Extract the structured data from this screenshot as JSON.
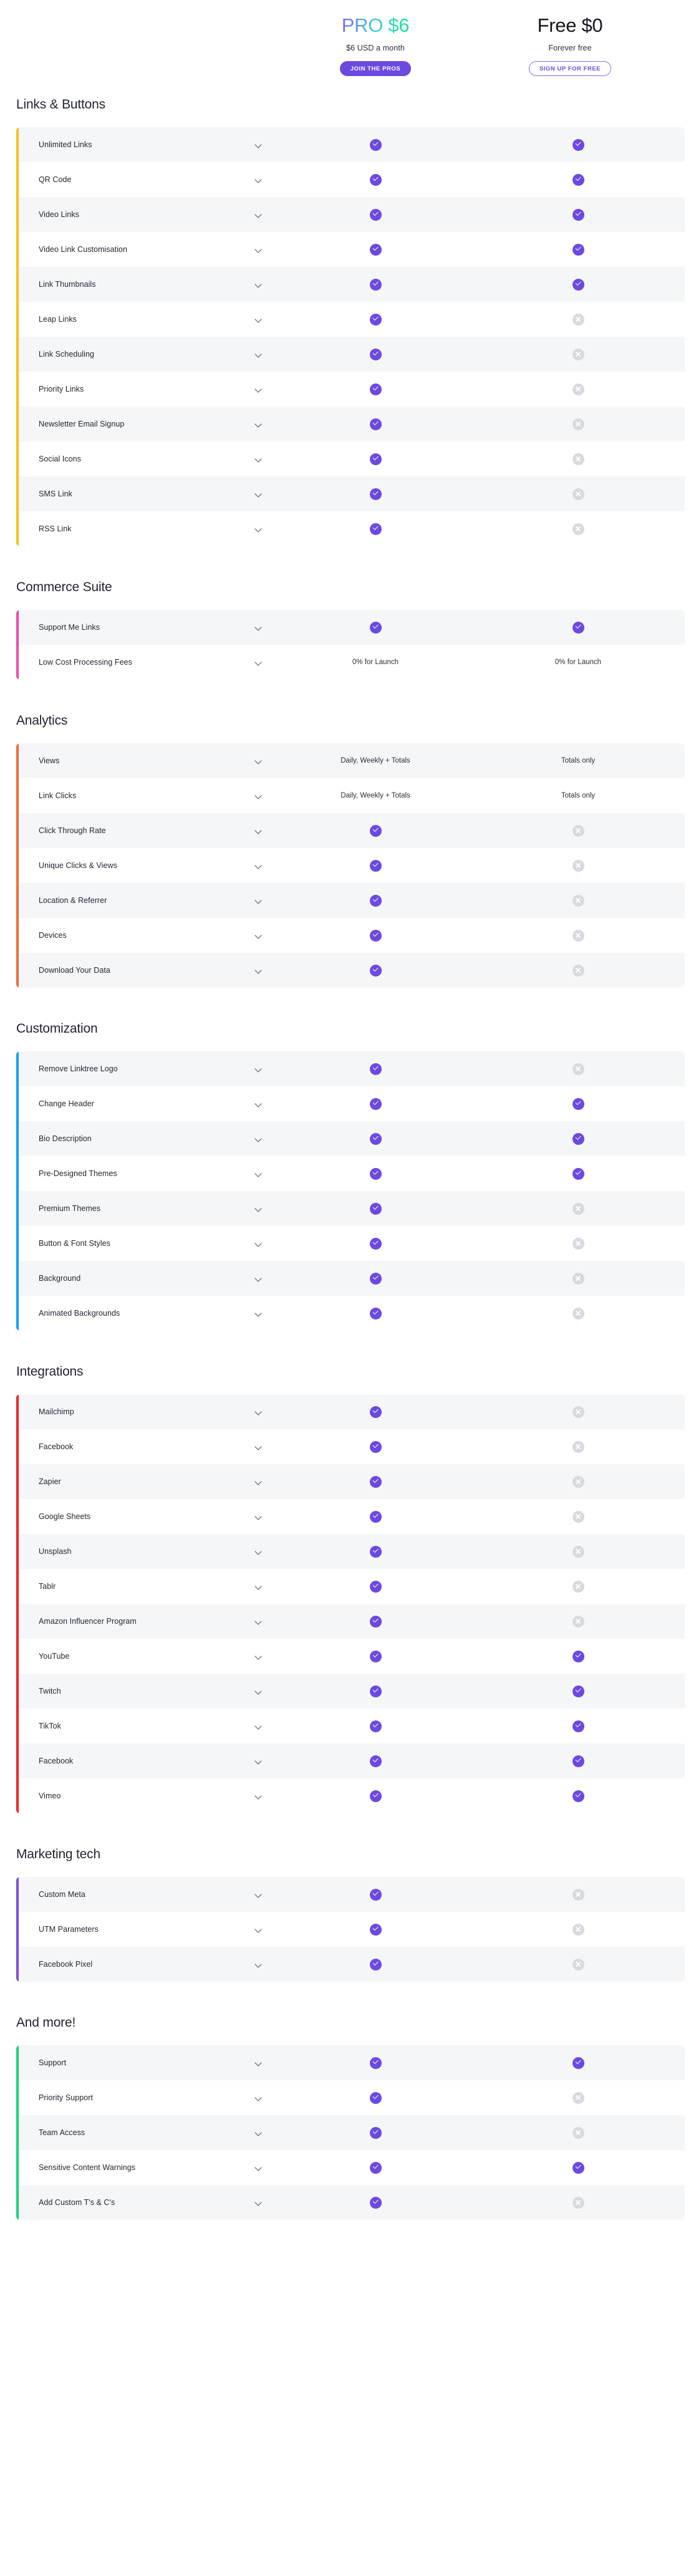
{
  "plans": [
    {
      "key": "pro",
      "title": "PRO $6",
      "subtitle": "$6 USD a month",
      "cta": "JOIN THE PROS",
      "cta_style": "filled"
    },
    {
      "key": "free",
      "title": "Free $0",
      "subtitle": "Forever free",
      "cta": "SIGN UP FOR FREE",
      "cta_style": "outline"
    }
  ],
  "colors": {
    "accent_purple": "#6c49e0",
    "pro_gradient_start": "#7b68ee",
    "pro_gradient_end": "#17e39a",
    "yes_mark": "#6c49e0",
    "no_mark": "#d7dade",
    "row_alt": "#f5f6f8",
    "pro_band": "rgba(108,73,224,0.055)",
    "section_bars": {
      "links_buttons": "#f7c11a",
      "commerce_suite": "#ef4aa8",
      "analytics": "#f26b3a",
      "customization": "#14a0ef",
      "integrations": "#f0212b",
      "marketing_tech": "#7b4ee0",
      "and_more": "#16d47e"
    }
  },
  "icons": {
    "yes": "check-circle-icon",
    "no": "cross-circle-icon",
    "expand": "chevron-down-icon"
  },
  "sections": [
    {
      "id": "links-buttons",
      "title": "Links & Buttons",
      "bar_color": "#f7c11a",
      "rows": [
        {
          "label": "Unlimited Links",
          "pro": "yes",
          "free": "yes"
        },
        {
          "label": "QR Code",
          "pro": "yes",
          "free": "yes"
        },
        {
          "label": "Video Links",
          "pro": "yes",
          "free": "yes"
        },
        {
          "label": "Video Link Customisation",
          "pro": "yes",
          "free": "yes"
        },
        {
          "label": "Link Thumbnails",
          "pro": "yes",
          "free": "yes"
        },
        {
          "label": "Leap Links",
          "pro": "yes",
          "free": "no"
        },
        {
          "label": "Link Scheduling",
          "pro": "yes",
          "free": "no"
        },
        {
          "label": "Priority Links",
          "pro": "yes",
          "free": "no"
        },
        {
          "label": "Newsletter Email Signup",
          "pro": "yes",
          "free": "no"
        },
        {
          "label": "Social Icons",
          "pro": "yes",
          "free": "no"
        },
        {
          "label": "SMS Link",
          "pro": "yes",
          "free": "no"
        },
        {
          "label": "RSS Link",
          "pro": "yes",
          "free": "no"
        }
      ]
    },
    {
      "id": "commerce-suite",
      "title": "Commerce Suite",
      "bar_color": "#ef4aa8",
      "rows": [
        {
          "label": "Support Me Links",
          "pro": "yes",
          "free": "yes"
        },
        {
          "label": "Low Cost Processing Fees",
          "pro": "0% for Launch",
          "free": "0% for Launch"
        }
      ]
    },
    {
      "id": "analytics",
      "title": "Analytics",
      "bar_color": "#f26b3a",
      "rows": [
        {
          "label": "Views",
          "pro": "Daily, Weekly + Totals",
          "free": "Totals only"
        },
        {
          "label": "Link Clicks",
          "pro": "Daily, Weekly + Totals",
          "free": "Totals only"
        },
        {
          "label": "Click Through Rate",
          "pro": "yes",
          "free": "no"
        },
        {
          "label": "Unique Clicks & Views",
          "pro": "yes",
          "free": "no"
        },
        {
          "label": "Location & Referrer",
          "pro": "yes",
          "free": "no"
        },
        {
          "label": "Devices",
          "pro": "yes",
          "free": "no"
        },
        {
          "label": "Download Your Data",
          "pro": "yes",
          "free": "no"
        }
      ]
    },
    {
      "id": "customization",
      "title": "Customization",
      "bar_color": "#14a0ef",
      "rows": [
        {
          "label": "Remove Linktree Logo",
          "pro": "yes",
          "free": "no"
        },
        {
          "label": "Change Header",
          "pro": "yes",
          "free": "yes"
        },
        {
          "label": "Bio Description",
          "pro": "yes",
          "free": "yes"
        },
        {
          "label": "Pre-Designed Themes",
          "pro": "yes",
          "free": "yes"
        },
        {
          "label": "Premium Themes",
          "pro": "yes",
          "free": "no"
        },
        {
          "label": "Button & Font Styles",
          "pro": "yes",
          "free": "no"
        },
        {
          "label": "Background",
          "pro": "yes",
          "free": "no"
        },
        {
          "label": "Animated Backgrounds",
          "pro": "yes",
          "free": "no"
        }
      ]
    },
    {
      "id": "integrations",
      "title": "Integrations",
      "bar_color": "#f0212b",
      "rows": [
        {
          "label": "Mailchimp",
          "pro": "yes",
          "free": "no"
        },
        {
          "label": "Facebook",
          "pro": "yes",
          "free": "no"
        },
        {
          "label": "Zapier",
          "pro": "yes",
          "free": "no"
        },
        {
          "label": "Google Sheets",
          "pro": "yes",
          "free": "no"
        },
        {
          "label": "Unsplash",
          "pro": "yes",
          "free": "no"
        },
        {
          "label": "Tablr",
          "pro": "yes",
          "free": "no"
        },
        {
          "label": "Amazon Influencer Program",
          "pro": "yes",
          "free": "no"
        },
        {
          "label": "YouTube",
          "pro": "yes",
          "free": "yes"
        },
        {
          "label": "Twitch",
          "pro": "yes",
          "free": "yes"
        },
        {
          "label": "TikTok",
          "pro": "yes",
          "free": "yes"
        },
        {
          "label": "Facebook",
          "pro": "yes",
          "free": "yes"
        },
        {
          "label": "Vimeo",
          "pro": "yes",
          "free": "yes"
        }
      ]
    },
    {
      "id": "marketing-tech",
      "title": "Marketing tech",
      "bar_color": "#7b4ee0",
      "rows": [
        {
          "label": "Custom Meta",
          "pro": "yes",
          "free": "no"
        },
        {
          "label": "UTM Parameters",
          "pro": "yes",
          "free": "no"
        },
        {
          "label": "Facebook Pixel",
          "pro": "yes",
          "free": "no"
        }
      ]
    },
    {
      "id": "and-more",
      "title": "And more!",
      "bar_color": "#16d47e",
      "rows": [
        {
          "label": "Support",
          "pro": "yes",
          "free": "yes"
        },
        {
          "label": "Priority Support",
          "pro": "yes",
          "free": "no"
        },
        {
          "label": "Team Access",
          "pro": "yes",
          "free": "no"
        },
        {
          "label": "Sensitive Content Warnings",
          "pro": "yes",
          "free": "yes"
        },
        {
          "label": "Add Custom T's & C's",
          "pro": "yes",
          "free": "no"
        }
      ]
    }
  ]
}
